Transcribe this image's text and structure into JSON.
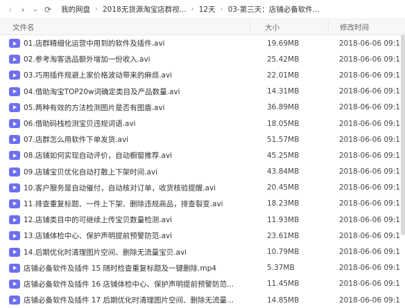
{
  "nav": {
    "back_icon": "chevron-left",
    "forward_icon": "chevron-right",
    "refresh_icon": "refresh"
  },
  "breadcrumbs": [
    "我的网盘",
    "2018无货源淘宝店群视...",
    "12天",
    "03-第三天：店铺必备软件..."
  ],
  "columns": {
    "name": "文件名",
    "size": "大小",
    "date": "修改时间"
  },
  "files": [
    {
      "name": "01.店群精细化运营中用到的软件及插件.avi",
      "size": "19.69MB",
      "date": "2018-06-06 09:1"
    },
    {
      "name": "02.参考淘客选品额外增加一份收入.avi",
      "size": "25.42MB",
      "date": "2018-06-06 09:1"
    },
    {
      "name": "03.巧用插件规避上家价格波动带来的麻烦.avi",
      "size": "22.01MB",
      "date": "2018-06-06 09:1"
    },
    {
      "name": "04.借助淘宝TOP20w词确定类目及产品数量.avi",
      "size": "14.31MB",
      "date": "2018-06-06 09:1"
    },
    {
      "name": "05.两种有效的方法检测图片是否有图盾.avi",
      "size": "36.89MB",
      "date": "2018-06-06 09:1"
    },
    {
      "name": "06.借助码栈检测宝贝违规词语.avi",
      "size": "18.05MB",
      "date": "2018-06-06 09:1"
    },
    {
      "name": "07.店群怎么用软件下单发货.avi",
      "size": "51.57MB",
      "date": "2018-06-06 09:1"
    },
    {
      "name": "08.店铺如何实现自动评价，自动橱窗推荐.avi",
      "size": "45.25MB",
      "date": "2018-06-06 09:1"
    },
    {
      "name": "09.店铺宝贝优化自动打散上下架时间.avi",
      "size": "43.84MB",
      "date": "2018-06-06 09:1"
    },
    {
      "name": "10.客户服务是自动催付，自动核对订单，收货核验提醒.avi",
      "size": "20.45MB",
      "date": "2018-06-06 09:1"
    },
    {
      "name": "11.排查重复标题、一件上下架、删除违规商品，排查裂变.avi",
      "size": "18.23MB",
      "date": "2018-06-06 09:1"
    },
    {
      "name": "12.店铺类目中的可继续上传宝贝数量检测.avi",
      "size": "11.93MB",
      "date": "2018-06-06 09:1"
    },
    {
      "name": "13.店铺体检中心、保护声明提前预警防范.avi",
      "size": "23.61MB",
      "date": "2018-06-06 09:1"
    },
    {
      "name": "14.后期优化时清理图片空间、删除无流量宝贝.avi",
      "size": "10.79MB",
      "date": "2018-06-06 09:1"
    },
    {
      "name": "店铺必备软件及插件 15 随时检查重复标题及一键删除.mp4",
      "size": "5.37MB",
      "date": "2018-06-06 09:1"
    },
    {
      "name": "店铺必备软件及插件 16 店铺体检中心、保护声明提前预警防范...",
      "size": "11.45MB",
      "date": "2018-06-06 09:1"
    },
    {
      "name": "店铺必备软件及插件 17 后期优化时清理图片空间、删除无流量...",
      "size": "14.85MB",
      "date": "2018-06-06 09:1"
    }
  ],
  "icons": {
    "file_icon": "video-file-icon",
    "file_icon_color": "#6e6ff0"
  }
}
